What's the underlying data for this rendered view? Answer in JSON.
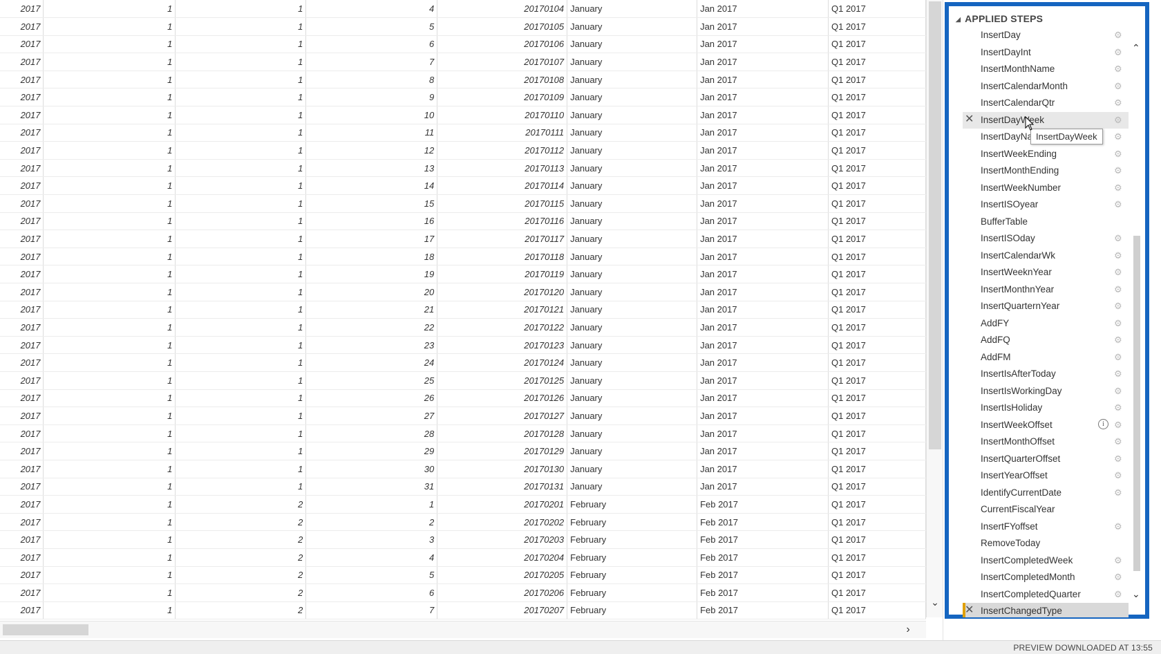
{
  "grid": {
    "rows": [
      [
        "2017",
        "1",
        "1",
        "4",
        "20170104",
        "January",
        "Jan 2017",
        "Q1 2017"
      ],
      [
        "2017",
        "1",
        "1",
        "5",
        "20170105",
        "January",
        "Jan 2017",
        "Q1 2017"
      ],
      [
        "2017",
        "1",
        "1",
        "6",
        "20170106",
        "January",
        "Jan 2017",
        "Q1 2017"
      ],
      [
        "2017",
        "1",
        "1",
        "7",
        "20170107",
        "January",
        "Jan 2017",
        "Q1 2017"
      ],
      [
        "2017",
        "1",
        "1",
        "8",
        "20170108",
        "January",
        "Jan 2017",
        "Q1 2017"
      ],
      [
        "2017",
        "1",
        "1",
        "9",
        "20170109",
        "January",
        "Jan 2017",
        "Q1 2017"
      ],
      [
        "2017",
        "1",
        "1",
        "10",
        "20170110",
        "January",
        "Jan 2017",
        "Q1 2017"
      ],
      [
        "2017",
        "1",
        "1",
        "11",
        "20170111",
        "January",
        "Jan 2017",
        "Q1 2017"
      ],
      [
        "2017",
        "1",
        "1",
        "12",
        "20170112",
        "January",
        "Jan 2017",
        "Q1 2017"
      ],
      [
        "2017",
        "1",
        "1",
        "13",
        "20170113",
        "January",
        "Jan 2017",
        "Q1 2017"
      ],
      [
        "2017",
        "1",
        "1",
        "14",
        "20170114",
        "January",
        "Jan 2017",
        "Q1 2017"
      ],
      [
        "2017",
        "1",
        "1",
        "15",
        "20170115",
        "January",
        "Jan 2017",
        "Q1 2017"
      ],
      [
        "2017",
        "1",
        "1",
        "16",
        "20170116",
        "January",
        "Jan 2017",
        "Q1 2017"
      ],
      [
        "2017",
        "1",
        "1",
        "17",
        "20170117",
        "January",
        "Jan 2017",
        "Q1 2017"
      ],
      [
        "2017",
        "1",
        "1",
        "18",
        "20170118",
        "January",
        "Jan 2017",
        "Q1 2017"
      ],
      [
        "2017",
        "1",
        "1",
        "19",
        "20170119",
        "January",
        "Jan 2017",
        "Q1 2017"
      ],
      [
        "2017",
        "1",
        "1",
        "20",
        "20170120",
        "January",
        "Jan 2017",
        "Q1 2017"
      ],
      [
        "2017",
        "1",
        "1",
        "21",
        "20170121",
        "January",
        "Jan 2017",
        "Q1 2017"
      ],
      [
        "2017",
        "1",
        "1",
        "22",
        "20170122",
        "January",
        "Jan 2017",
        "Q1 2017"
      ],
      [
        "2017",
        "1",
        "1",
        "23",
        "20170123",
        "January",
        "Jan 2017",
        "Q1 2017"
      ],
      [
        "2017",
        "1",
        "1",
        "24",
        "20170124",
        "January",
        "Jan 2017",
        "Q1 2017"
      ],
      [
        "2017",
        "1",
        "1",
        "25",
        "20170125",
        "January",
        "Jan 2017",
        "Q1 2017"
      ],
      [
        "2017",
        "1",
        "1",
        "26",
        "20170126",
        "January",
        "Jan 2017",
        "Q1 2017"
      ],
      [
        "2017",
        "1",
        "1",
        "27",
        "20170127",
        "January",
        "Jan 2017",
        "Q1 2017"
      ],
      [
        "2017",
        "1",
        "1",
        "28",
        "20170128",
        "January",
        "Jan 2017",
        "Q1 2017"
      ],
      [
        "2017",
        "1",
        "1",
        "29",
        "20170129",
        "January",
        "Jan 2017",
        "Q1 2017"
      ],
      [
        "2017",
        "1",
        "1",
        "30",
        "20170130",
        "January",
        "Jan 2017",
        "Q1 2017"
      ],
      [
        "2017",
        "1",
        "1",
        "31",
        "20170131",
        "January",
        "Jan 2017",
        "Q1 2017"
      ],
      [
        "2017",
        "1",
        "2",
        "1",
        "20170201",
        "February",
        "Feb 2017",
        "Q1 2017"
      ],
      [
        "2017",
        "1",
        "2",
        "2",
        "20170202",
        "February",
        "Feb 2017",
        "Q1 2017"
      ],
      [
        "2017",
        "1",
        "2",
        "3",
        "20170203",
        "February",
        "Feb 2017",
        "Q1 2017"
      ],
      [
        "2017",
        "1",
        "2",
        "4",
        "20170204",
        "February",
        "Feb 2017",
        "Q1 2017"
      ],
      [
        "2017",
        "1",
        "2",
        "5",
        "20170205",
        "February",
        "Feb 2017",
        "Q1 2017"
      ],
      [
        "2017",
        "1",
        "2",
        "6",
        "20170206",
        "February",
        "Feb 2017",
        "Q1 2017"
      ],
      [
        "2017",
        "1",
        "2",
        "7",
        "20170207",
        "February",
        "Feb 2017",
        "Q1 2017"
      ]
    ]
  },
  "applied_steps": {
    "title": "APPLIED STEPS",
    "tooltip": "InsertDayWeek",
    "items": [
      {
        "label": "InsertDay",
        "gear": true
      },
      {
        "label": "InsertDayInt",
        "gear": true
      },
      {
        "label": "InsertMonthName",
        "gear": true
      },
      {
        "label": "InsertCalendarMonth",
        "gear": true
      },
      {
        "label": "InsertCalendarQtr",
        "gear": true
      },
      {
        "label": "InsertDayWeek",
        "gear": true,
        "hover": true,
        "delete": true
      },
      {
        "label": "InsertDayName",
        "gear": true
      },
      {
        "label": "InsertWeekEnding",
        "gear": true
      },
      {
        "label": "InsertMonthEnding",
        "gear": true
      },
      {
        "label": "InsertWeekNumber",
        "gear": true
      },
      {
        "label": "InsertISOyear",
        "gear": true
      },
      {
        "label": "BufferTable",
        "gear": false
      },
      {
        "label": "InsertISOday",
        "gear": true
      },
      {
        "label": "InsertCalendarWk",
        "gear": true
      },
      {
        "label": "InsertWeeknYear",
        "gear": true
      },
      {
        "label": "InsertMonthnYear",
        "gear": true
      },
      {
        "label": "InsertQuarternYear",
        "gear": true
      },
      {
        "label": "AddFY",
        "gear": true
      },
      {
        "label": "AddFQ",
        "gear": true
      },
      {
        "label": "AddFM",
        "gear": true
      },
      {
        "label": "InsertIsAfterToday",
        "gear": true
      },
      {
        "label": "InsertIsWorkingDay",
        "gear": true
      },
      {
        "label": "InsertIsHoliday",
        "gear": true
      },
      {
        "label": "InsertWeekOffset",
        "gear": true,
        "info": true
      },
      {
        "label": "InsertMonthOffset",
        "gear": true
      },
      {
        "label": "InsertQuarterOffset",
        "gear": true
      },
      {
        "label": "InsertYearOffset",
        "gear": true
      },
      {
        "label": "IdentifyCurrentDate",
        "gear": true
      },
      {
        "label": "CurrentFiscalYear",
        "gear": false
      },
      {
        "label": "InsertFYoffset",
        "gear": true
      },
      {
        "label": "RemoveToday",
        "gear": false
      },
      {
        "label": "InsertCompletedWeek",
        "gear": true
      },
      {
        "label": "InsertCompletedMonth",
        "gear": true
      },
      {
        "label": "InsertCompletedQuarter",
        "gear": true
      },
      {
        "label": "InsertChangedType",
        "gear": false,
        "selected": true,
        "delete": true
      }
    ]
  },
  "status": {
    "message": "PREVIEW DOWNLOADED AT 13:55"
  },
  "icons": {
    "gear": "gear-icon",
    "delete": "close-icon",
    "info": "info-icon",
    "scroll_up": "chevron-up-icon",
    "scroll_down": "chevron-down-icon",
    "scroll_right": "chevron-right-icon",
    "collapse": "triangle-collapse-icon"
  },
  "colors": {
    "pane_border": "#1565c0",
    "selected_marker": "#e0a000"
  }
}
